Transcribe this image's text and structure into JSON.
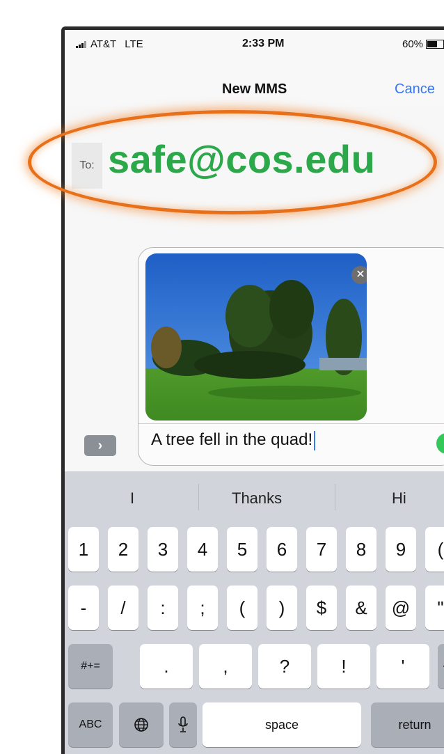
{
  "status_bar": {
    "carrier": "AT&T",
    "network": "LTE",
    "time": "2:33 PM",
    "battery": "60%"
  },
  "nav": {
    "title": "New MMS",
    "cancel_label": "Cance"
  },
  "to_field": {
    "label": "To:",
    "value": "safe@cos.edu"
  },
  "compose": {
    "attachment_icon": "photo-tree-on-lawn",
    "remove_icon": "close-icon",
    "message_text": "A tree fell in the quad!",
    "send_icon": "arrow-up-icon"
  },
  "expand_icon": "chevron-right-icon",
  "predictions": [
    "I",
    "Thanks",
    "Hi"
  ],
  "keyboard": {
    "row1": [
      "1",
      "2",
      "3",
      "4",
      "5",
      "6",
      "7",
      "8",
      "9",
      "("
    ],
    "row2": [
      "-",
      "/",
      ":",
      ";",
      "(",
      ")",
      "$",
      "&",
      "@",
      "\""
    ],
    "row3_left": "#+=",
    "row3": [
      ".",
      ",",
      "?",
      "!",
      "'"
    ],
    "row4": {
      "abc": "ABC",
      "globe_icon": "globe-icon",
      "mic_icon": "microphone-icon",
      "space": "space",
      "return": "return"
    },
    "delete_icon": "backspace-icon"
  },
  "colors": {
    "highlight_oval": "#e8701a",
    "email_green": "#2ba84a",
    "link_blue": "#3478f6",
    "send_green": "#34c759"
  }
}
